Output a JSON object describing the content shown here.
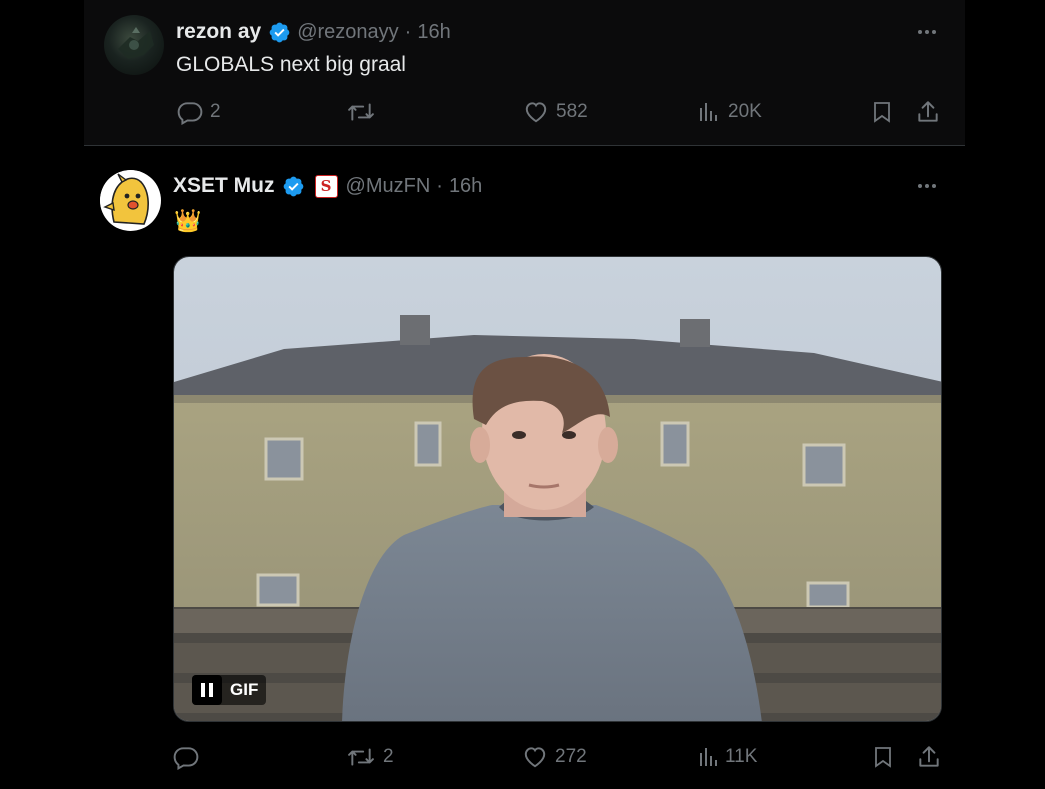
{
  "tweets": [
    {
      "display_name": "rezon ay",
      "handle": "@rezonayy",
      "separator": "·",
      "time": "16h",
      "text": "GLOBALS next big graal",
      "replies": "2",
      "reposts": "",
      "likes": "582",
      "views": "20K"
    },
    {
      "display_name": "XSET Muz",
      "handle": "@MuzFN",
      "separator": "·",
      "time": "16h",
      "text": "👑",
      "affiliate_badge": "S",
      "replies": "",
      "reposts": "2",
      "likes": "272",
      "views": "11K",
      "media": {
        "type": "gif",
        "label": "GIF"
      }
    }
  ],
  "icons": {
    "verified": "verified-badge-icon",
    "reply": "reply-icon",
    "repost": "repost-icon",
    "like": "heart-icon",
    "views": "views-icon",
    "bookmark": "bookmark-icon",
    "share": "share-icon",
    "more": "more-icon"
  },
  "colors": {
    "background": "#000000",
    "text_primary": "#e7e9ea",
    "text_secondary": "#71767b",
    "verified_blue": "#1d9bf0",
    "border": "#2f3336"
  }
}
